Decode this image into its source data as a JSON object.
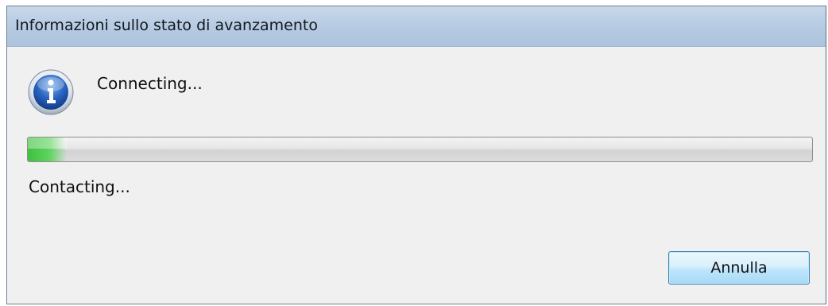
{
  "window": {
    "title": "Informazioni sullo stato di avanzamento"
  },
  "dialog": {
    "icon": "info-icon",
    "message": "Connecting...",
    "progress": {
      "value_percent": 5,
      "fill_color": "#4cc94c"
    },
    "status_text": "Contacting...",
    "cancel_label": "Annulla"
  },
  "colors": {
    "titlebar": "#b8cce3",
    "background": "#f0f0f0",
    "button_border": "#3c7fb1"
  }
}
